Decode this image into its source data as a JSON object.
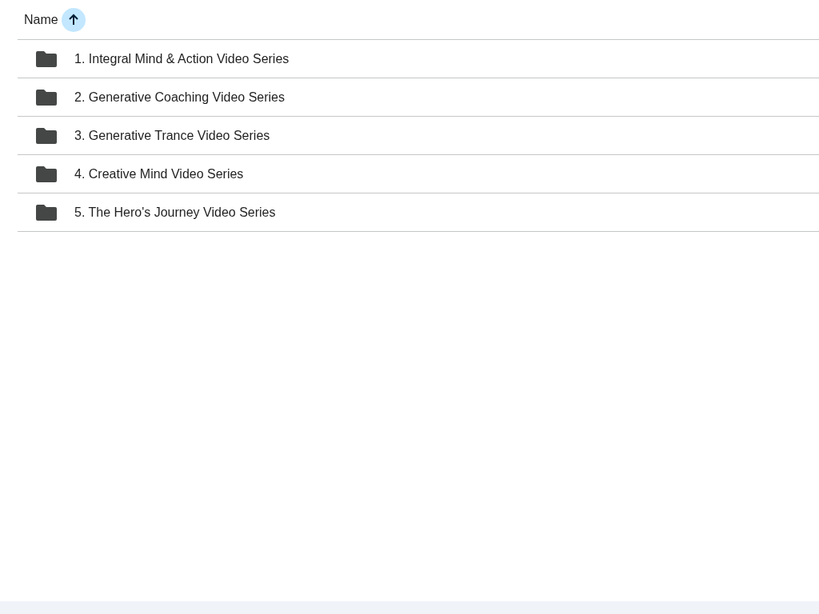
{
  "header": {
    "column": "Name",
    "sort_ascending": true
  },
  "rows": [
    {
      "name": "1. Integral Mind & Action Video Series",
      "kind": "folder"
    },
    {
      "name": "2. Generative Coaching Video Series",
      "kind": "folder"
    },
    {
      "name": "3. Generative Trance Video Series",
      "kind": "folder"
    },
    {
      "name": "4. Creative Mind Video Series",
      "kind": "folder"
    },
    {
      "name": "5. The Hero's Journey Video Series",
      "kind": "folder"
    }
  ]
}
